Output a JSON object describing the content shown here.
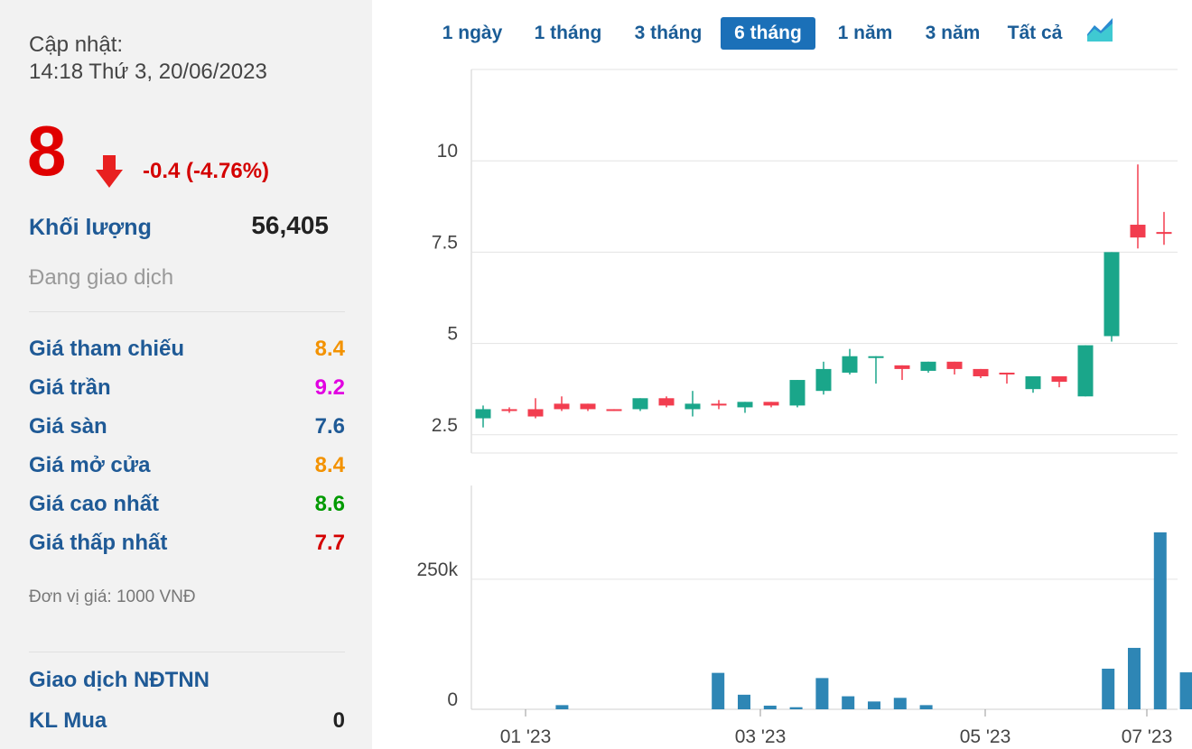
{
  "header": {
    "updated_label": "Cập nhật:",
    "updated_time": "14:18 Thứ 3, 20/06/2023"
  },
  "quote": {
    "price": "8",
    "trend_icon": "arrow-down-icon",
    "change": "-0.4 (-4.76%)",
    "volume_label": "Khối lượng",
    "volume_value": "56,405",
    "status": "Đang giao dịch"
  },
  "stats": [
    {
      "label": "Giá tham chiếu",
      "value": "8.4",
      "color": "#f39200"
    },
    {
      "label": "Giá trần",
      "value": "9.2",
      "color": "#e100e1"
    },
    {
      "label": "Giá sàn",
      "value": "7.6",
      "color": "#1f5a96"
    },
    {
      "label": "Giá mở cửa",
      "value": "8.4",
      "color": "#f39200"
    },
    {
      "label": "Giá cao nhất",
      "value": "8.6",
      "color": "#009a00"
    },
    {
      "label": "Giá thấp nhất",
      "value": "7.7",
      "color": "#d40000"
    }
  ],
  "unit_note": "Đơn vị giá: 1000 VNĐ",
  "foreign": {
    "title": "Giao dịch NĐTNN",
    "buy_label": "KL Mua",
    "buy_value": "0"
  },
  "tabs": [
    {
      "label": "1 ngày",
      "active": false
    },
    {
      "label": "1 tháng",
      "active": false
    },
    {
      "label": "3 tháng",
      "active": false
    },
    {
      "label": "6 tháng",
      "active": true
    },
    {
      "label": "1 năm",
      "active": false
    },
    {
      "label": "3 năm",
      "active": false
    },
    {
      "label": "Tất cả",
      "active": false
    }
  ],
  "chart_icon": "area-chart-icon",
  "colors": {
    "up": "#1aa68a",
    "down": "#f23d4f",
    "volume": "#2e86b5",
    "grid": "#e3e3e3"
  },
  "chart_data": [
    {
      "type": "candlestick",
      "x_tick_labels": [
        "01 '23",
        "03 '23",
        "05 '23",
        "07 '23"
      ],
      "y_ticks": [
        "2.5",
        "5",
        "7.5",
        "10"
      ],
      "ylim": [
        2,
        12.5
      ],
      "candles": [
        {
          "open": 2.95,
          "high": 3.3,
          "low": 2.7,
          "close": 3.2
        },
        {
          "open": 3.2,
          "high": 3.25,
          "low": 3.1,
          "close": 3.15
        },
        {
          "open": 3.2,
          "high": 3.5,
          "low": 2.95,
          "close": 3.0
        },
        {
          "open": 3.35,
          "high": 3.55,
          "low": 3.15,
          "close": 3.2
        },
        {
          "open": 3.35,
          "high": 3.35,
          "low": 3.15,
          "close": 3.2
        },
        {
          "open": 3.2,
          "high": 3.2,
          "low": 3.15,
          "close": 3.15
        },
        {
          "open": 3.2,
          "high": 3.5,
          "low": 3.15,
          "close": 3.5
        },
        {
          "open": 3.5,
          "high": 3.55,
          "low": 3.25,
          "close": 3.3
        },
        {
          "open": 3.2,
          "high": 3.7,
          "low": 3.0,
          "close": 3.35
        },
        {
          "open": 3.35,
          "high": 3.45,
          "low": 3.2,
          "close": 3.3
        },
        {
          "open": 3.25,
          "high": 3.4,
          "low": 3.1,
          "close": 3.4
        },
        {
          "open": 3.4,
          "high": 3.4,
          "low": 3.25,
          "close": 3.3
        },
        {
          "open": 3.3,
          "high": 4.0,
          "low": 3.25,
          "close": 4.0
        },
        {
          "open": 3.7,
          "high": 4.5,
          "low": 3.6,
          "close": 4.3
        },
        {
          "open": 4.2,
          "high": 4.85,
          "low": 4.15,
          "close": 4.65
        },
        {
          "open": 4.65,
          "high": 4.65,
          "low": 3.9,
          "close": 4.65
        },
        {
          "open": 4.4,
          "high": 4.4,
          "low": 4.0,
          "close": 4.3
        },
        {
          "open": 4.25,
          "high": 4.5,
          "low": 4.2,
          "close": 4.5
        },
        {
          "open": 4.5,
          "high": 4.5,
          "low": 4.15,
          "close": 4.3
        },
        {
          "open": 4.3,
          "high": 4.3,
          "low": 4.05,
          "close": 4.1
        },
        {
          "open": 4.2,
          "high": 4.2,
          "low": 3.9,
          "close": 4.15
        },
        {
          "open": 3.75,
          "high": 4.1,
          "low": 3.65,
          "close": 4.1
        },
        {
          "open": 4.1,
          "high": 4.1,
          "low": 3.8,
          "close": 3.95
        },
        {
          "open": 3.55,
          "high": 4.95,
          "low": 3.55,
          "close": 4.95
        },
        {
          "open": 5.2,
          "high": 7.5,
          "low": 5.05,
          "close": 7.5
        },
        {
          "open": 8.25,
          "high": 9.9,
          "low": 7.6,
          "close": 7.9
        },
        {
          "open": 8.05,
          "high": 8.6,
          "low": 7.7,
          "close": 8.0
        }
      ]
    },
    {
      "type": "bar",
      "series_name": "volume",
      "y_ticks": [
        "0",
        "250k"
      ],
      "ylim": [
        0,
        430000
      ],
      "values": [
        0,
        0,
        0,
        8000,
        0,
        0,
        0,
        0,
        0,
        70000,
        28000,
        7000,
        4000,
        60000,
        25000,
        15000,
        22000,
        8000,
        0,
        0,
        0,
        0,
        0,
        0,
        78000,
        118000,
        340000,
        71000
      ]
    }
  ]
}
